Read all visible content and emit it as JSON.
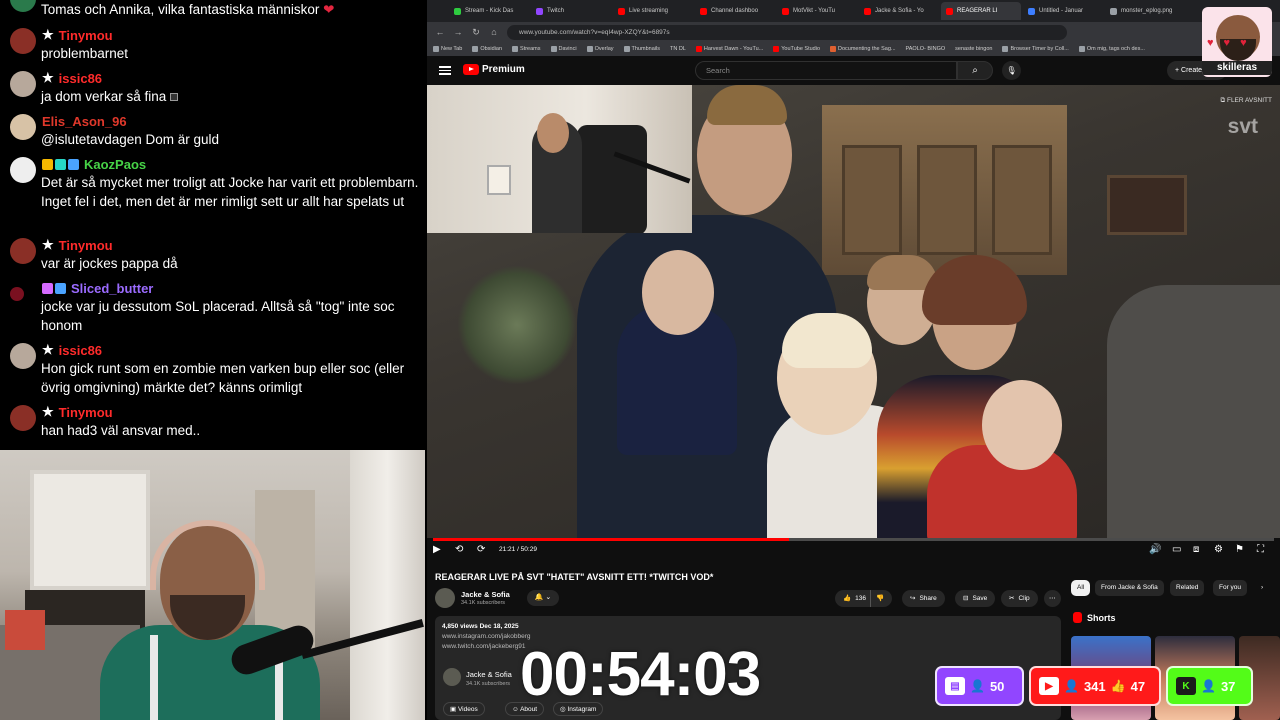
{
  "chat": {
    "messages": [
      {
        "user": "",
        "badges": [],
        "text": "Tomas och Annika, vilka fantastiska människor",
        "name_color": "#ffffff",
        "avatar": "#2a7a4b"
      },
      {
        "user": "Tinymou",
        "badges": [
          "star"
        ],
        "text": "problembarnet",
        "name_color": "#ff2b2b",
        "avatar": "#8a2f26"
      },
      {
        "user": "issic86",
        "badges": [
          "star"
        ],
        "text": "ja dom verkar så fina",
        "name_color": "#ff2b2b",
        "avatar": "#b7a89b"
      },
      {
        "user": "Elis_Ason_96",
        "badges": [],
        "text": "@islutetavdagen Dom är guld",
        "name_color": "#e0382b",
        "avatar": "#d7c2a6"
      },
      {
        "user": "KaozPaos",
        "badges": [
          "crown",
          "chip",
          "gem"
        ],
        "text": "Det är så mycket mer troligt att Jocke har varit ett problembarn. Inget fel i det, men det är mer rimligt sett ur allt har spelats ut",
        "name_color": "#47d347",
        "avatar": "#eeeeee"
      },
      {
        "user": "Tinymou",
        "badges": [
          "star"
        ],
        "text": "var är jockes pappa då",
        "name_color": "#ff2b2b",
        "avatar": "#8a2f26"
      },
      {
        "user": "Sliced_butter",
        "badges": [
          "box",
          "gem"
        ],
        "text": "jocke var ju dessutom SoL placerad. Alltså så \"tog\" inte soc honom",
        "name_color": "#9b6bff",
        "avatar": "#7a1020"
      },
      {
        "user": "issic86",
        "badges": [
          "star"
        ],
        "text": "Hon gick runt som en zombie men varken bup eller soc (eller övrig omgivning) märkte det? känns orimligt",
        "name_color": "#ff2b2b",
        "avatar": "#b7a89b"
      },
      {
        "user": "Tinymou",
        "badges": [
          "star"
        ],
        "text": "han had3 väl ansvar med..",
        "name_color": "#ff2b2b",
        "avatar": "#8a2f26"
      }
    ]
  },
  "browser": {
    "tabs": [
      "Stream - Kick Das",
      "Twitch",
      "Live streaming",
      "Channel dashboo",
      "MotVikt - YouTu",
      "Jacke & Sofia - Yo",
      "REAGERAR LI",
      "Untitled - Januar",
      "monster_eplog.png"
    ],
    "active_tab_index": 6,
    "tab_colors": [
      "#2ecc40",
      "#9146ff",
      "#ff0000",
      "#ff0000",
      "#ff0000",
      "#ff0000",
      "#ff0000",
      "#3d7eff",
      "#9aa0a6"
    ],
    "url": "www.youtube.com/watch?v=eqI4wp-XZQY&t=6897s",
    "bookmarks": [
      "New Tab",
      "Obsidian",
      "Streams",
      "Davinci",
      "Overlay",
      "Thumbnails",
      "TN DL",
      "Harvest Dawn - YouTu...",
      "YouTube Studio",
      "Documenting the Sag...",
      "PAOLO- BINGO",
      "senaste bingon",
      "Browser Timer by Coll...",
      "Om mig, tags och des..."
    ]
  },
  "youtube": {
    "logo_text": "Premium",
    "search_placeholder": "Search",
    "create_label": "Create",
    "video_overlay_more": "FLER AVSNITT",
    "watermark": "svt",
    "time_display": "21:21 / 50:29",
    "progress": 0.423,
    "title": "REAGERAR LIVE PÅ SVT \"HATET\" AVSNITT ETT! *TWITCH VOD*",
    "channel_name": "Jacke & Sofia",
    "channel_subs": "34.1K subscribers",
    "likes": "136",
    "share_label": "Share",
    "save_label": "Save",
    "clip_label": "Clip",
    "desc_meta": "4,850 views  Dec 18, 2025",
    "desc_link1": "www.instagram.com/jakobberg",
    "desc_link2": "www.twitch.com/jackeberg91",
    "desc_channel_name": "Jacke & Sofia",
    "desc_channel_subs": "34.1K subscribers",
    "desc_tabs": [
      "Videos",
      "About",
      "Instagram"
    ],
    "chips": [
      "All",
      "From Jacke & Sofia",
      "Related",
      "For you"
    ],
    "shorts_label": "Shorts"
  },
  "logo_card": {
    "text": "skilleras"
  },
  "overlay": {
    "timer": "00:54:03",
    "twitch_viewers": "50",
    "youtube_viewers": "341",
    "youtube_likes": "47",
    "kick_viewers": "37",
    "colors": {
      "twitch": "#9146ff",
      "youtube": "#ff1a1a",
      "kick": "#53fc18"
    }
  }
}
